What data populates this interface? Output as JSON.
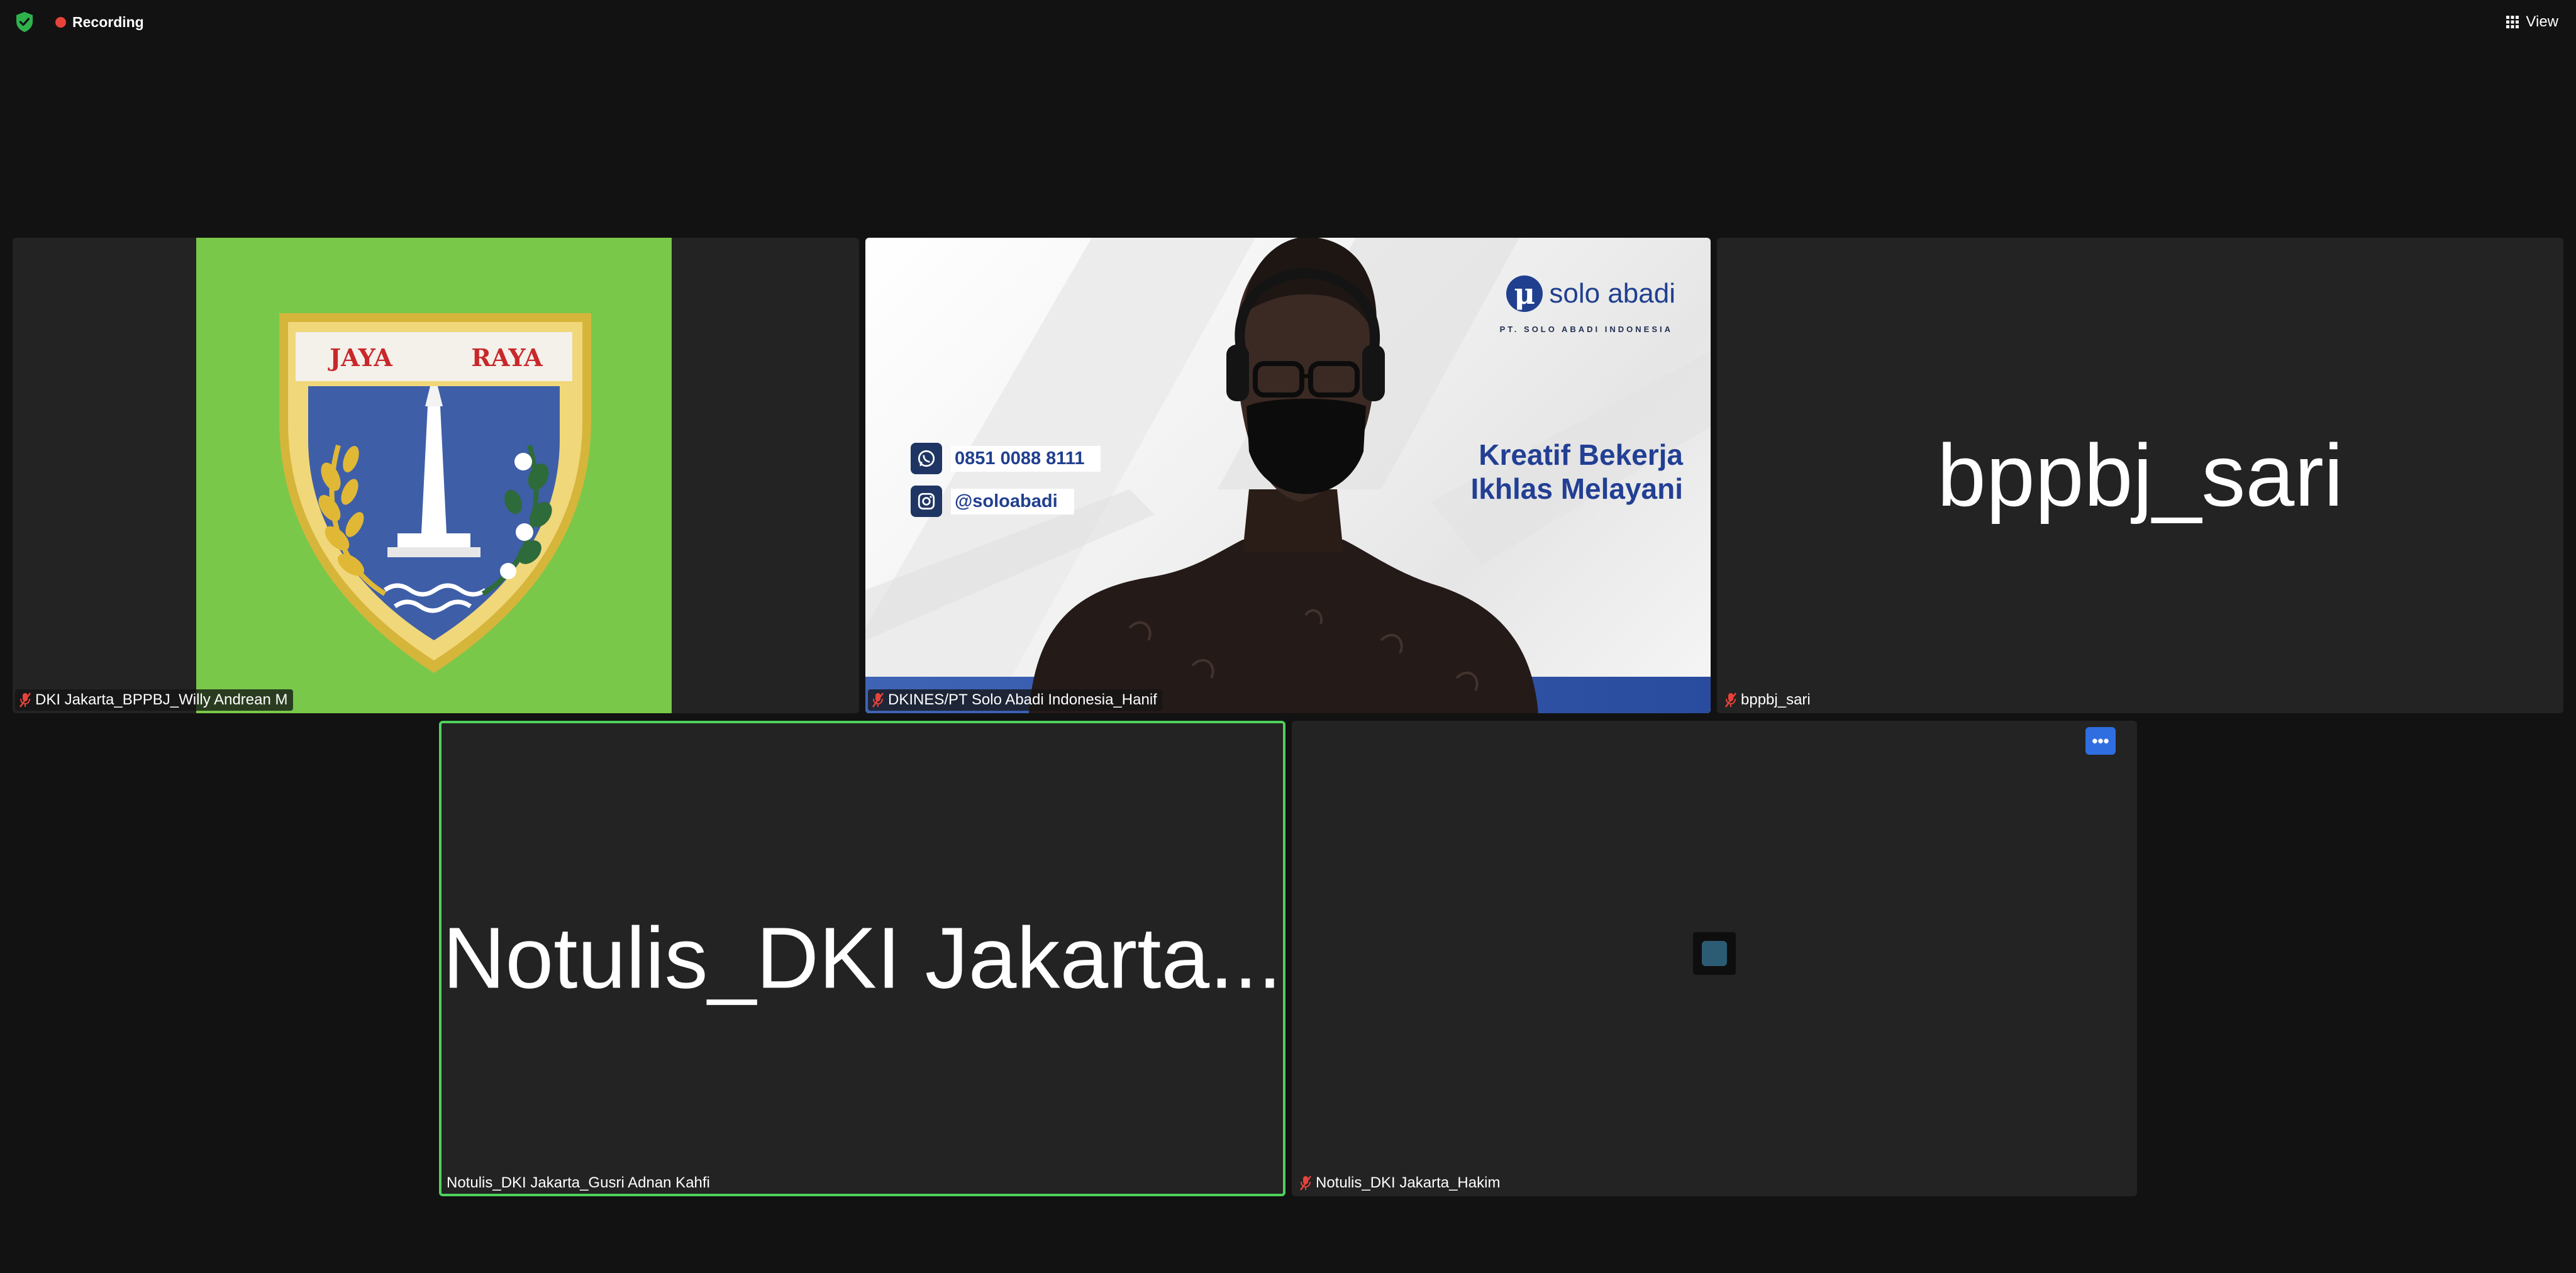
{
  "topbar": {
    "recording_label": "Recording",
    "view_label": "View",
    "colors": {
      "recording_dot": "#e8433a",
      "shield": "#2fb24c"
    }
  },
  "participants": [
    {
      "display_name": "DKI Jakarta_BPPBJ_Willy Andrean M",
      "audio": "muted",
      "video": "on",
      "content": {
        "emblem_banner_left": "JAYA",
        "emblem_banner_right": "RAYA"
      }
    },
    {
      "display_name": "DKINES/PT Solo Abadi Indonesia_Hanif",
      "audio": "muted",
      "video": "on",
      "background": {
        "brand_name": "solo abadi",
        "brand_sub": "PT. SOLO ABADI INDONESIA",
        "tagline_line1": "Kreatif Bekerja",
        "tagline_line2": "Ikhlas Melayani",
        "phone": "0851 0088 8111",
        "instagram": "@soloabadi"
      }
    },
    {
      "display_name": "bppbj_sari",
      "audio": "muted",
      "video": "off",
      "big_label": "bppbj_sari"
    },
    {
      "display_name": "Notulis_DKI Jakarta_Gusri Adnan Kahfi",
      "audio": "on",
      "video": "off",
      "active_speaker": true,
      "big_label": "Notulis_DKI Jakarta..."
    },
    {
      "display_name": "Notulis_DKI Jakarta_Hakim",
      "audio": "muted",
      "video": "off",
      "more_label": "•••"
    }
  ],
  "icons": {
    "security": "shield-check-icon",
    "view": "grid-icon",
    "muted": "mic-muted-icon",
    "more": "more-icon"
  },
  "colors": {
    "background": "#121212",
    "tile": "#232323",
    "active_speaker_border": "#4fd15c",
    "more_button": "#2f6ee0",
    "muted_icon": "#e8433a"
  }
}
